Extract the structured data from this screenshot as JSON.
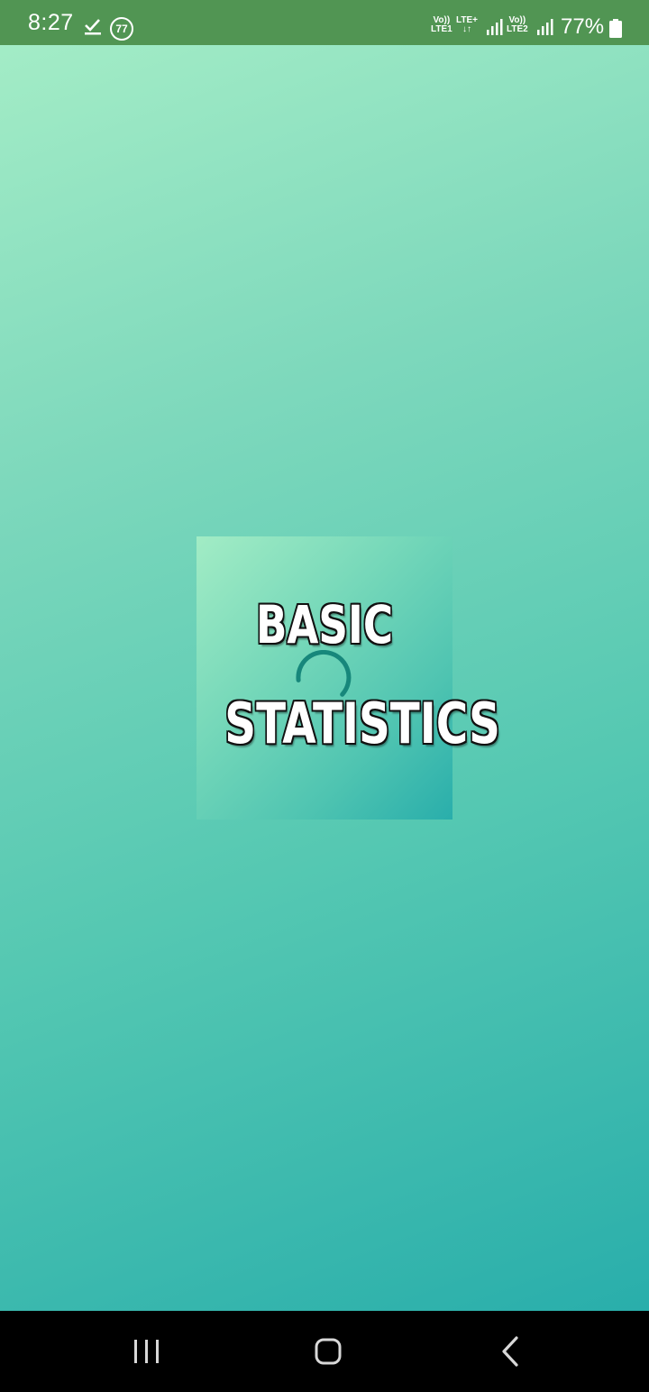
{
  "status_bar": {
    "time": "8:27",
    "notification_count": "77",
    "net_vo1_top": "Vo))",
    "net_vo1_bottom": "LTE1",
    "net_lte_top": "LTE+",
    "net_lte_arrows": "↓↑",
    "net_vo2_top": "Vo))",
    "net_vo2_bottom": "LTE2",
    "battery_percent": "77%",
    "background_color": "#519553"
  },
  "splash": {
    "logo_line1": "BASIC",
    "logo_line2": "STATISTICS",
    "spinner_color": "#17877b",
    "gradient_start": "#a3ecc6",
    "gradient_end": "#29aeab"
  },
  "nav_bar": {
    "recents_icon": "recents-icon",
    "home_icon": "home-icon",
    "back_icon": "back-icon"
  }
}
